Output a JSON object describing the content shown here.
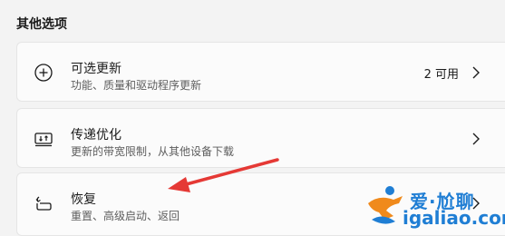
{
  "section": {
    "title": "其他选项"
  },
  "cards": [
    {
      "title": "可选更新",
      "subtitle": "功能、质量和驱动程序更新",
      "right_value": "2 可用",
      "icon": "plus-circle-icon"
    },
    {
      "title": "传递优化",
      "subtitle": "更新的带宽限制，从其他设备下载",
      "icon": "delivery-optimization-icon"
    },
    {
      "title": "恢复",
      "subtitle": "重置、高级启动、返回",
      "icon": "recovery-icon"
    }
  ],
  "watermark": {
    "cn": "爱·尬聊",
    "en": "igaliao.com"
  },
  "colors": {
    "annotation_arrow": "#e53935",
    "watermark": "#1f7ed4",
    "watermark_accent": "#f08a1c"
  }
}
